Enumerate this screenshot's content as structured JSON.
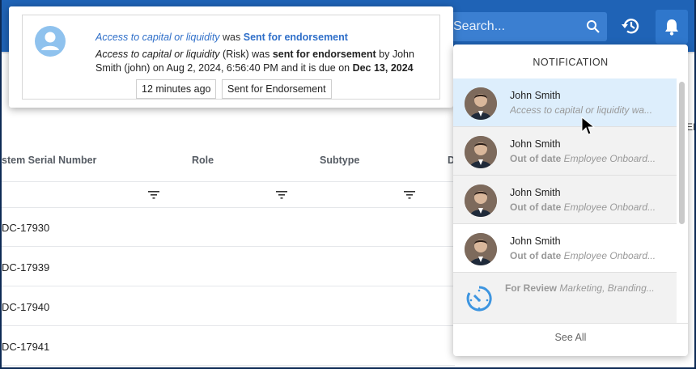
{
  "header": {
    "search_placeholder": "Search...",
    "icons": [
      "search-icon",
      "history-icon",
      "bell-icon"
    ]
  },
  "table": {
    "columns": [
      "stem Serial Number",
      "Role",
      "Subtype",
      "D"
    ],
    "rows": [
      "DC-17930",
      "DC-17939",
      "DC-17940",
      "DC-17941"
    ],
    "edge_text": "EI"
  },
  "toast": {
    "title_item": "Access to capital or liquidity",
    "title_was": "was",
    "title_status": "Sent for endorsement",
    "body_item": "Access to capital or liquidity",
    "body_type": "(Risk) was",
    "body_action": "sent for endorsement",
    "body_by": "by John Smith (john) on Aug 2, 2024, 6:56:40 PM and it is due on",
    "body_due": "Dec 13, 2024",
    "tag_time": "12 minutes ago",
    "tag_status": "Sent for Endorsement"
  },
  "notifications": {
    "title": "NOTIFICATION",
    "items": [
      {
        "name": "John Smith",
        "status": "",
        "text": "Access to capital or liquidity wa..."
      },
      {
        "name": "John Smith",
        "status": "Out of date",
        "text": "Employee Onboard..."
      },
      {
        "name": "John Smith",
        "status": "Out of date",
        "text": "Employee Onboard..."
      },
      {
        "name": "John Smith",
        "status": "Out of date",
        "text": "Employee Onboard..."
      }
    ],
    "review": {
      "status": "For Review",
      "text": "Marketing, Branding..."
    },
    "see_all": "See All"
  },
  "colors": {
    "header_blue": "#1f63b6",
    "link_blue": "#2f6fc9",
    "highlight": "#ddeefc"
  }
}
